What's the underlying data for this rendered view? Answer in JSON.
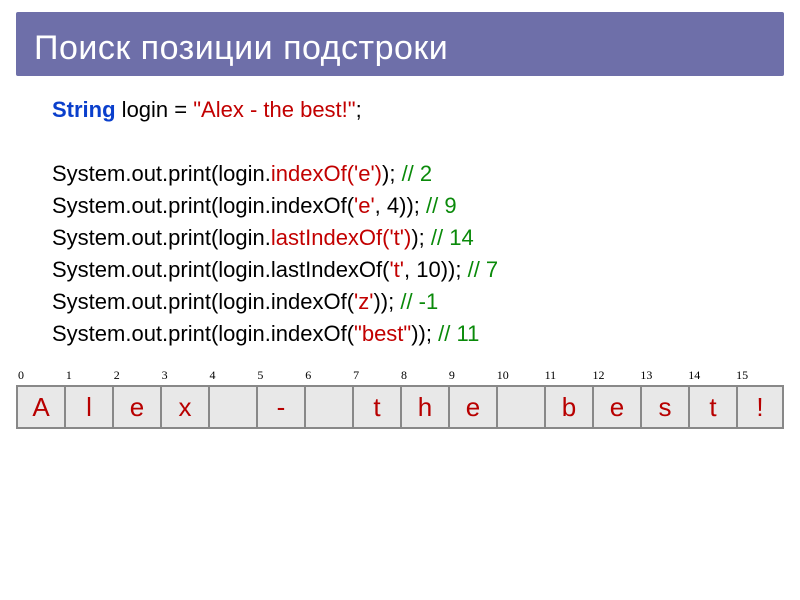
{
  "title": "Поиск позиции подстроки",
  "code": {
    "line1": {
      "kw": "String",
      "mid": " login = ",
      "str": "\"Alex - the best!\"",
      "end": ";"
    },
    "lines": [
      {
        "pre": "System.out.print(login.",
        "method": "indexOf",
        "args": "('e')",
        "suffix": "); ",
        "comment": "// 2",
        "methodRed": true,
        "argsRed": true
      },
      {
        "pre": "System.out.print(login.indexOf(",
        "method": "",
        "args": "'e'",
        "suffix": ", 4)); ",
        "comment": "// 9",
        "methodRed": false,
        "argsRed": true
      },
      {
        "pre": "System.out.print(login.",
        "method": "lastIndexOf",
        "args": "('t')",
        "suffix": "); ",
        "comment": "// 14",
        "methodRed": true,
        "argsRed": true
      },
      {
        "pre": "System.out.print(login.lastIndexOf(",
        "method": "",
        "args": "'t'",
        "suffix": ", 10)); ",
        "comment": "// 7",
        "methodRed": false,
        "argsRed": true
      },
      {
        "pre": "System.out.print(login.indexOf(",
        "method": "",
        "args": "'z'",
        "suffix": ")); ",
        "comment": "// -1",
        "methodRed": false,
        "argsRed": true
      },
      {
        "pre": "System.out.print(login.indexOf(",
        "method": "",
        "args": "\"best\"",
        "suffix": ")); ",
        "comment": "// 11",
        "methodRed": false,
        "argsRed": true
      }
    ]
  },
  "indices": [
    "0",
    "1",
    "2",
    "3",
    "4",
    "5",
    "6",
    "7",
    "8",
    "9",
    "10",
    "11",
    "12",
    "13",
    "14",
    "15"
  ],
  "chars": [
    "A",
    "l",
    "e",
    "x",
    " ",
    "-",
    " ",
    "t",
    "h",
    "e",
    " ",
    "b",
    "e",
    "s",
    "t",
    "!"
  ]
}
